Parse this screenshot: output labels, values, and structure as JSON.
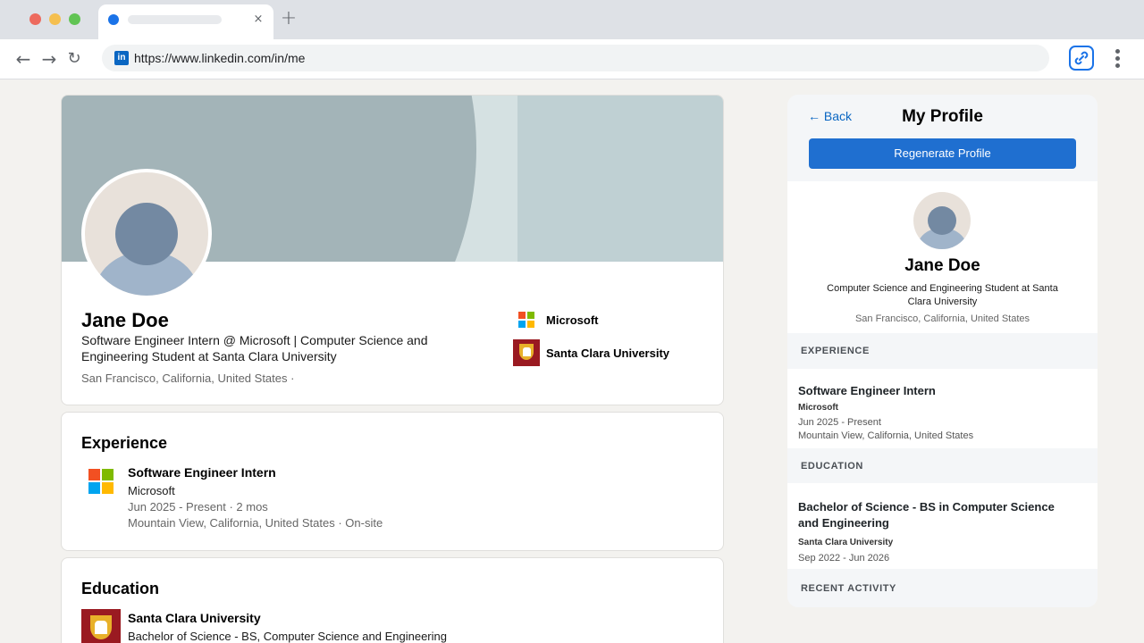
{
  "browser": {
    "url": "https://www.linkedin.com/in/me",
    "tab_close": "×",
    "new_tab": "+",
    "back": "←",
    "forward": "→",
    "reload": "↻",
    "site_icon_text": "in"
  },
  "profile": {
    "name": "Jane Doe",
    "headline": "Software Engineer Intern @ Microsoft | Computer Science and Engineering Student at Santa Clara University",
    "location": "San Francisco, California, United States ·",
    "current_company": "Microsoft",
    "school": "Santa Clara University"
  },
  "experience": {
    "title": "Experience",
    "items": [
      {
        "role": "Software Engineer Intern",
        "company": "Microsoft",
        "dates": "Jun 2025 - Present · 2 mos",
        "location": "Mountain View, California, United States · On-site"
      }
    ]
  },
  "education": {
    "title": "Education",
    "items": [
      {
        "school": "Santa Clara University",
        "degree": "Bachelor of Science - BS, Computer Science and Engineering"
      }
    ]
  },
  "panel": {
    "back_label": "← Back",
    "title": "My Profile",
    "regenerate_label": "Regenerate Profile",
    "name": "Jane Doe",
    "headline": "Computer Science and Engineering Student at Santa Clara University",
    "location": "San Francisco, California, United States",
    "experience_heading": "EXPERIENCE",
    "experience": {
      "role": "Software Engineer Intern",
      "company": "Microsoft",
      "dates": "Jun 2025 - Present",
      "location": "Mountain View, California, United States"
    },
    "education_heading": "EDUCATION",
    "education": {
      "degree": "Bachelor of Science - BS in Computer Science and Engineering",
      "school": "Santa Clara University",
      "dates": "Sep 2022 - Jun 2026"
    },
    "activity_heading": "RECENT ACTIVITY"
  },
  "colors": {
    "linkedin_blue": "#0a66c2",
    "button_blue": "#1f6fd0",
    "scu_red": "#9a1a21"
  },
  "icons": {
    "extension": "chain-link-chat-icon",
    "menu": "kebab-menu-icon",
    "microsoft": "microsoft-logo",
    "scu": "santa-clara-university-logo"
  }
}
